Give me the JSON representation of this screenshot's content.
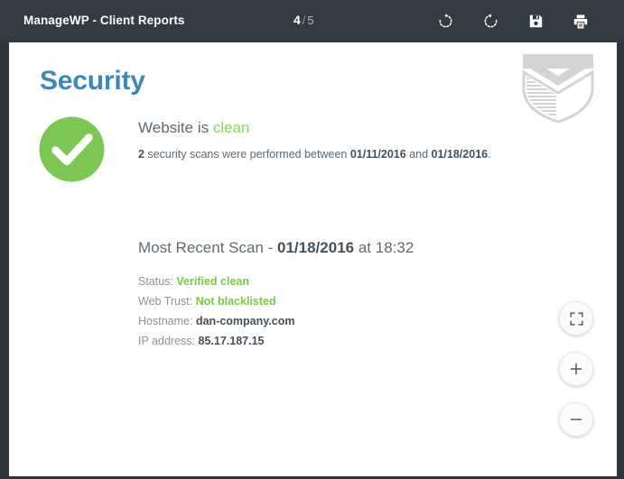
{
  "toolbar": {
    "title": "ManageWP - Client Reports",
    "current_page": "4",
    "separator": "/",
    "total_pages": "5",
    "actions": [
      {
        "name": "rotate-clockwise-icon",
        "label": "Rotate clockwise"
      },
      {
        "name": "rotate-counterclockwise-icon",
        "label": "Rotate counterclockwise"
      },
      {
        "name": "save-icon",
        "label": "Save"
      },
      {
        "name": "print-icon",
        "label": "Print"
      }
    ]
  },
  "report": {
    "title": "Security",
    "status": {
      "headline_prefix": "Website is ",
      "headline_state": "clean",
      "scan_count": "2",
      "summary_mid": " security scans were performed between ",
      "date_from": "01/11/2016",
      "summary_and": " and ",
      "date_to": "01/18/2016",
      "summary_end": "."
    },
    "recent_scan": {
      "heading_prefix": "Most Recent Scan - ",
      "heading_date": "01/18/2016",
      "heading_suffix": " at 18:32",
      "rows": [
        {
          "label": "Status:",
          "value": "Verified clean",
          "tone": "good"
        },
        {
          "label": "Web Trust:",
          "value": "Not blacklisted",
          "tone": "good"
        },
        {
          "label": "Hostname:",
          "value": "dan-company.com",
          "tone": "plain"
        },
        {
          "label": "IP address:",
          "value": "85.17.187.15",
          "tone": "plain"
        }
      ]
    }
  },
  "float_controls": [
    {
      "name": "fullscreen-button",
      "label": "Fit to screen"
    },
    {
      "name": "zoom-in-button",
      "label": "+"
    },
    {
      "name": "zoom-out-button",
      "label": "−"
    }
  ],
  "colors": {
    "toolbar_bg": "#323a42",
    "app_bg": "#2e363d",
    "title_blue": "#3c88b9",
    "badge_green": "#7dc855",
    "clean_green": "#8ed45f",
    "value_green": "#7ac943",
    "body_gray": "#5f6a72",
    "label_gray": "#8d9298",
    "shield_gray": "#d4d4d4"
  }
}
